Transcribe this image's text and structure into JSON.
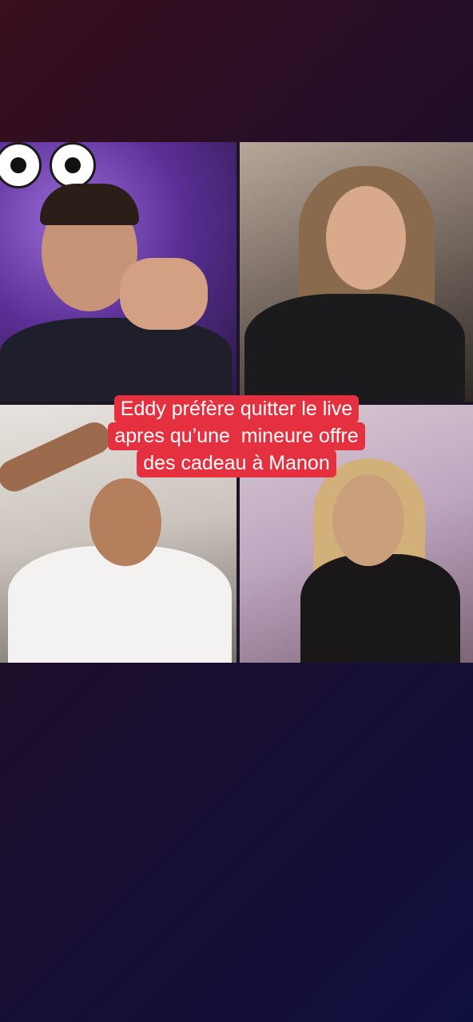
{
  "caption": {
    "lines": [
      "Eddy préfère quitter le live",
      "apres qu’une  mineure offre",
      "des cadeau à Manon"
    ]
  },
  "colors": {
    "caption_bg": "#e5303f",
    "caption_text": "#ffffff",
    "page_bg_start": "#3a0f1e",
    "page_bg_end": "#0f0f3e"
  },
  "tiles": [
    {
      "id": "top-left",
      "content": "man-purple-background"
    },
    {
      "id": "top-right",
      "content": "woman-dark-top"
    },
    {
      "id": "bottom-left",
      "content": "man-white-shirt-drinking"
    },
    {
      "id": "bottom-right",
      "content": "woman-black-top"
    }
  ]
}
